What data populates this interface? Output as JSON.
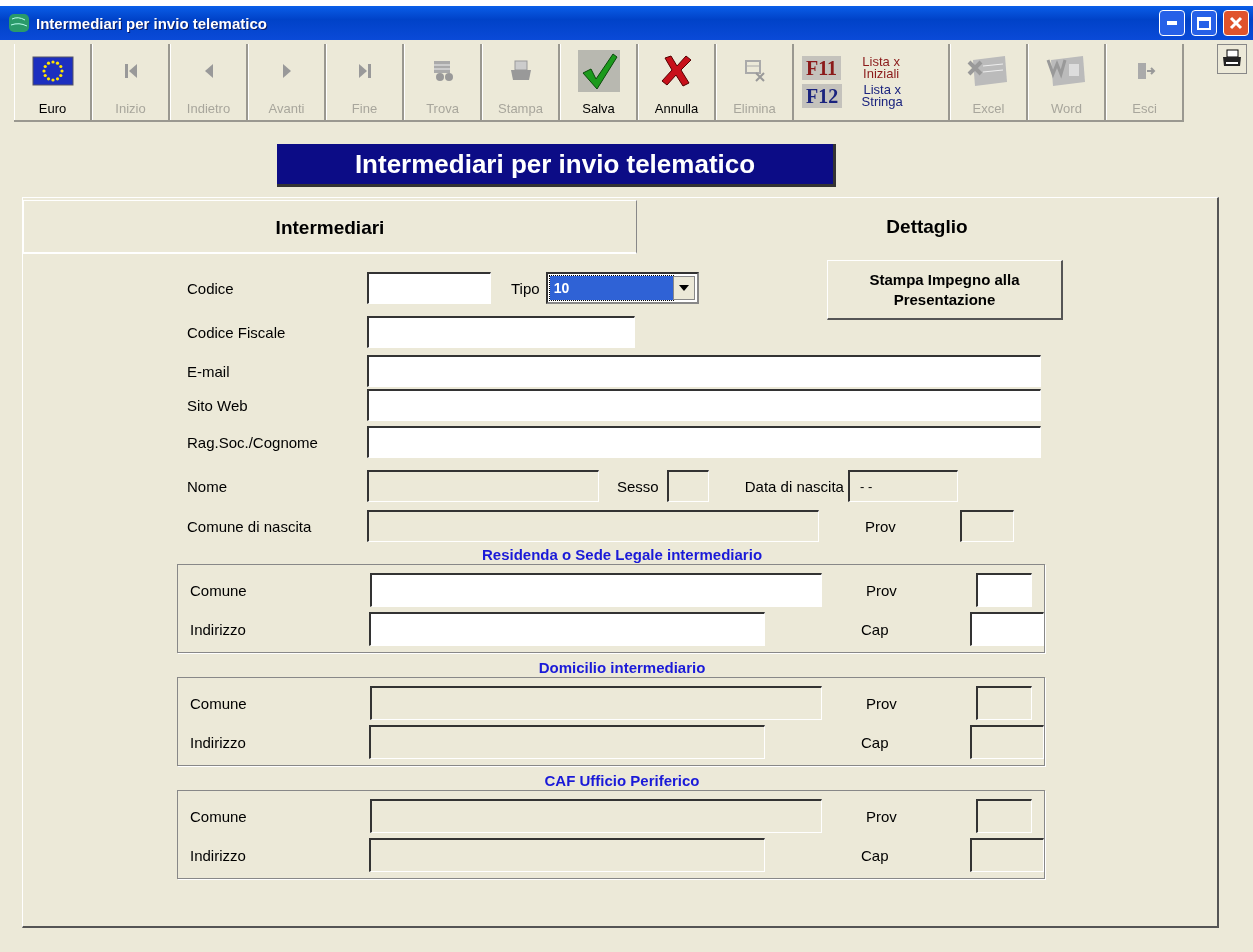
{
  "window": {
    "title": "Intermediari per invio telematico"
  },
  "toolbar": {
    "buttons": [
      {
        "label": "Euro",
        "disabled": false
      },
      {
        "label": "Inizio",
        "disabled": true
      },
      {
        "label": "Indietro",
        "disabled": true
      },
      {
        "label": "Avanti",
        "disabled": true
      },
      {
        "label": "Fine",
        "disabled": true
      },
      {
        "label": "Trova",
        "disabled": true
      },
      {
        "label": "Stampa",
        "disabled": true
      },
      {
        "label": "Salva",
        "disabled": false
      },
      {
        "label": "Annulla",
        "disabled": false
      },
      {
        "label": "Elimina",
        "disabled": true
      }
    ],
    "shortcuts": [
      {
        "key": "F11",
        "label": "Lista x Iniziali",
        "color": "#8b1a1a"
      },
      {
        "key": "F12",
        "label": "Lista x Stringa",
        "color": "#1a237e"
      }
    ],
    "buttons_right": [
      {
        "label": "Excel",
        "disabled": true
      },
      {
        "label": "Word",
        "disabled": true
      },
      {
        "label": "Esci",
        "disabled": true
      }
    ]
  },
  "header": {
    "title": "Intermediari per invio telematico"
  },
  "tabs": [
    {
      "label": "Intermediari",
      "selected": false
    },
    {
      "label": "Dettaglio",
      "selected": true
    }
  ],
  "print_button": {
    "label": "Stampa Impegno alla Presentazione"
  },
  "form": {
    "rows": [
      {
        "label": "Codice",
        "fields": [
          {
            "disabled": false
          },
          {
            "label": "Tipo",
            "kind": "select",
            "value": "10"
          }
        ]
      },
      {
        "label": "Codice Fiscale",
        "fields": [
          {
            "disabled": false
          }
        ]
      },
      {
        "label": "E-mail",
        "fields": [
          {
            "disabled": false
          }
        ]
      },
      {
        "label": "Sito Web",
        "fields": [
          {
            "disabled": false
          }
        ]
      },
      {
        "label": "Rag.Soc./Cognome",
        "fields": [
          {
            "disabled": false
          }
        ]
      },
      {
        "label": "Nome",
        "fields": [
          {
            "disabled": true
          },
          {
            "label": "Sesso",
            "disabled": true
          },
          {
            "label": "Data di nascita",
            "value": "- -",
            "disabled": true
          }
        ]
      },
      {
        "label": "Comune di nascita",
        "fields": [
          {
            "disabled": true
          },
          {
            "label": "Prov",
            "disabled": true
          }
        ]
      }
    ]
  },
  "sections": [
    {
      "title": "Residenda o Sede Legale intermediario",
      "disabled": false,
      "rows": [
        {
          "label": "Comune",
          "side_label": "Prov"
        },
        {
          "label": "Indirizzo",
          "side_label": "Cap"
        }
      ]
    },
    {
      "title": "Domicilio intermediario",
      "disabled": true,
      "rows": [
        {
          "label": "Comune",
          "side_label": "Prov"
        },
        {
          "label": "Indirizzo",
          "side_label": "Cap"
        }
      ]
    },
    {
      "title": "CAF Ufficio Periferico",
      "disabled": true,
      "rows": [
        {
          "label": "Comune",
          "side_label": "Prov"
        },
        {
          "label": "Indirizzo",
          "side_label": "Cap"
        }
      ]
    }
  ]
}
